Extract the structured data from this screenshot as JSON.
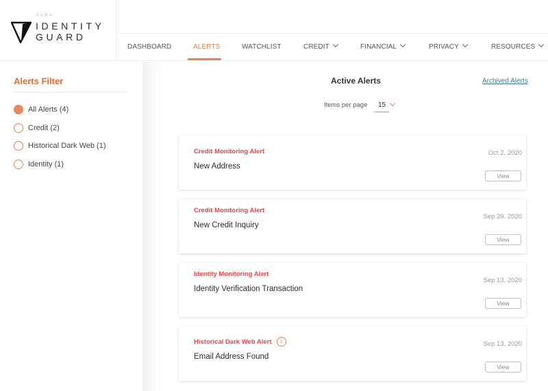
{
  "brand": {
    "aura": "ĀURA",
    "line1": "IDENTITY",
    "line2": "GUARD"
  },
  "nav": {
    "items": [
      {
        "label": "DASHBOARD",
        "active": false,
        "dropdown": false
      },
      {
        "label": "ALERTS",
        "active": true,
        "dropdown": false
      },
      {
        "label": "WATCHLIST",
        "active": false,
        "dropdown": false
      },
      {
        "label": "CREDIT",
        "active": false,
        "dropdown": true
      },
      {
        "label": "FINANCIAL",
        "active": false,
        "dropdown": true
      },
      {
        "label": "PRIVACY",
        "active": false,
        "dropdown": true
      },
      {
        "label": "RESOURCES",
        "active": false,
        "dropdown": true
      }
    ]
  },
  "sidebar": {
    "title": "Alerts Filter",
    "filters": [
      {
        "label": "All Alerts (4)",
        "selected": true
      },
      {
        "label": "Credit (2)",
        "selected": false
      },
      {
        "label": "Historical Dark Web (1)",
        "selected": false
      },
      {
        "label": "Identity (1)",
        "selected": false
      }
    ]
  },
  "main": {
    "title": "Active Alerts",
    "archived_link": "Archived Alerts",
    "items_per_page_label": "Items per page",
    "items_per_page_value": "15",
    "alerts": [
      {
        "type": "Credit Monitoring Alert",
        "title": "New Address",
        "date": "Oct 2, 2020",
        "view_label": "View",
        "info": false
      },
      {
        "type": "Credit Monitoring Alert",
        "title": "New Credit Inquiry",
        "date": "Sep 29, 2020",
        "view_label": "View",
        "info": false
      },
      {
        "type": "Identity Monitoring Alert",
        "title": "Identity Verification Transaction",
        "date": "Sep 13, 2020",
        "view_label": "View",
        "info": false
      },
      {
        "type": "Historical Dark Web Alert",
        "title": "Email Address Found",
        "date": "Sep 13, 2020",
        "view_label": "View",
        "info": true,
        "info_icon": "i"
      }
    ]
  },
  "colors": {
    "accent": "#e8824f",
    "alert_type": "#e04848",
    "link": "#3d7a87"
  }
}
